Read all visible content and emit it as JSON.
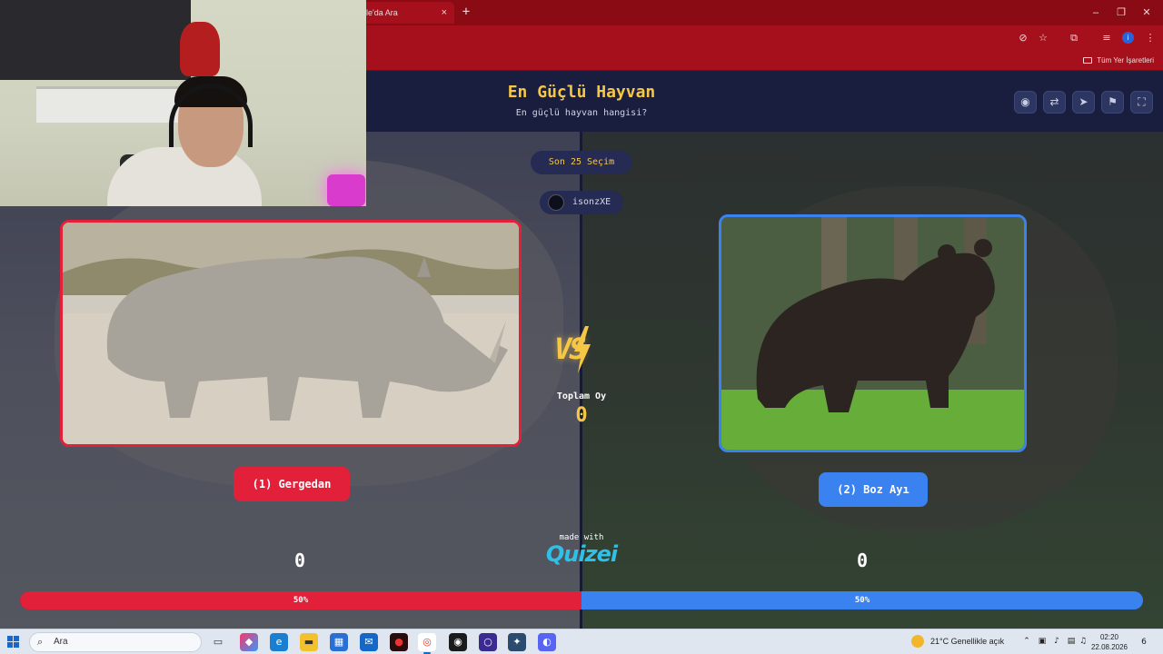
{
  "browser": {
    "tab_title": "gle'da Ara",
    "tab_close": "×",
    "new_tab": "+",
    "window_controls": {
      "minimize": "–",
      "restore": "❐",
      "close": "✕"
    },
    "toolbar_icons": [
      "eye-off-icon",
      "star-icon",
      "extensions-icon",
      "media-icon",
      "profile-icon",
      "menu-icon"
    ],
    "profile_initial": "i",
    "bookmarks_all": "Tüm Yer İşaretleri"
  },
  "quiz": {
    "title": "En Güçlü Hayvan",
    "subtitle": "En güçlü hayvan hangisi?",
    "header_buttons": [
      "eye-icon",
      "share-icon",
      "send-icon",
      "flag-icon",
      "fullscreen-icon"
    ],
    "recent_label": "Son 25 Seçim",
    "username": "isonzXE",
    "vs_label": "VS",
    "total_label": "Toplam Oy",
    "total_value": "0",
    "options": [
      {
        "label": "(1) Gergedan",
        "score": "0",
        "percent_label": "50%",
        "percent": 50,
        "color": "#e3203a",
        "image": "rhinoceros"
      },
      {
        "label": "(2) Boz Ayı",
        "score": "0",
        "percent_label": "50%",
        "percent": 50,
        "color": "#3a82f0",
        "image": "brown bear"
      }
    ],
    "made_with": "made with",
    "brand": "Quizei",
    "accent": "#f6c744"
  },
  "taskbar": {
    "search_placeholder": "Ara",
    "weather": "21°C  Genellikle açık",
    "time": "02:20",
    "date": "22.08.2026",
    "notifications": "6"
  }
}
